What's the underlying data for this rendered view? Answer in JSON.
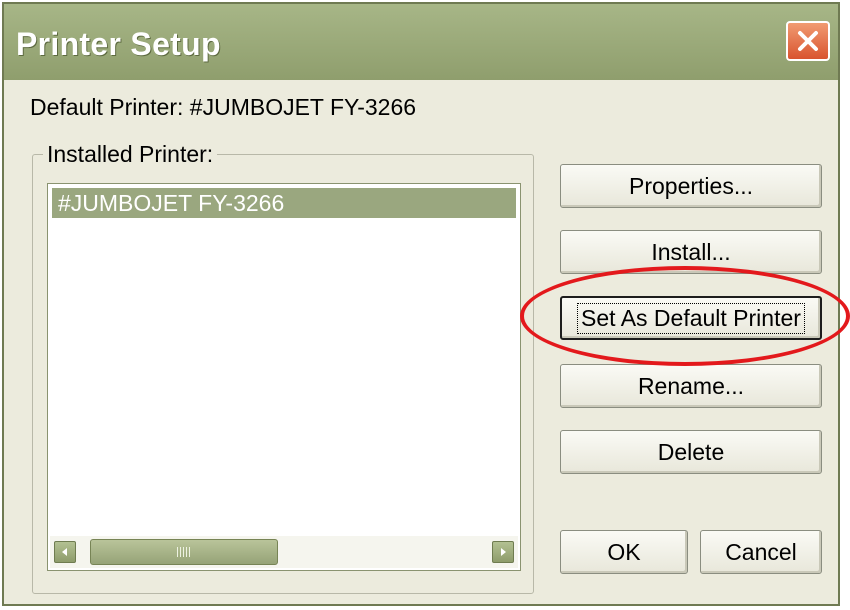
{
  "window": {
    "title": "Printer Setup"
  },
  "default_printer": {
    "label": "Default Printer: #JUMBOJET FY-3266"
  },
  "installed": {
    "group_label": "Installed Printer:",
    "items": [
      "#JUMBOJET FY-3266"
    ],
    "selected_index": 0
  },
  "buttons": {
    "properties": "Properties...",
    "install": "Install...",
    "set_default": "Set As Default Printer",
    "rename": "Rename...",
    "delete": "Delete",
    "ok": "OK",
    "cancel": "Cancel"
  },
  "colors": {
    "titlebar": "#9aa97a",
    "selection": "#9aa77f",
    "annotation": "#e3191c",
    "close": "#d9542f"
  },
  "icons": {
    "close": "close-icon",
    "scroll_left": "arrow-left-icon",
    "scroll_right": "arrow-right-icon"
  }
}
